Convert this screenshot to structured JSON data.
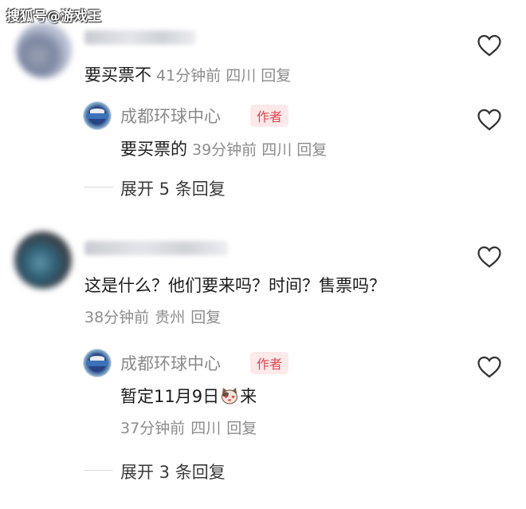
{
  "watermark": "搜狐号@游戏王",
  "comments": [
    {
      "text": "要买票不",
      "meta": {
        "time": "41分钟前",
        "location": "四川",
        "reply_label": "回复"
      },
      "reply": {
        "author": "成都环球中心",
        "author_tag": "作者",
        "text": "要买票的",
        "meta": {
          "time": "39分钟前",
          "location": "四川",
          "reply_label": "回复"
        }
      },
      "expand_label": "展开 5 条回复"
    },
    {
      "text": "这是什么？他们要来吗？时间？售票吗？",
      "meta": {
        "time": "38分钟前",
        "location": "贵州",
        "reply_label": "回复"
      },
      "reply": {
        "author": "成都环球中心",
        "author_tag": "作者",
        "text_before": "暂定11月9日",
        "text_after": "来",
        "meta": {
          "time": "37分钟前",
          "location": "四川",
          "reply_label": "回复"
        }
      },
      "expand_label": "展开 3 条回复"
    }
  ],
  "icons": {
    "like": "heart-outline-icon",
    "emoji": "cat-heart-eyes-emoji"
  },
  "colors": {
    "author_tag_text": "#e2464e",
    "author_tag_bg": "#fde9ea",
    "meta_gray": "#8c8c8c"
  }
}
